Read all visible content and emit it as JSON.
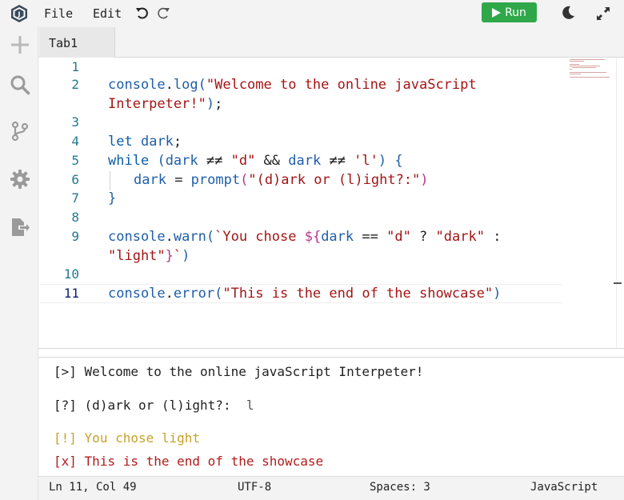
{
  "menu": {
    "file": "File",
    "edit": "Edit"
  },
  "toolbar": {
    "run_label": "Run",
    "run_color": "#2fa84a"
  },
  "tabs": [
    {
      "label": "Tab1"
    }
  ],
  "editor": {
    "line_numbers": [
      "1",
      "2",
      "",
      "3",
      "4",
      "5",
      "6",
      "7",
      "8",
      "9",
      "",
      "10",
      "11"
    ],
    "code": {
      "l2a": [
        "console",
        ".",
        "log",
        "(",
        "\"Welcome to the online javaScript"
      ],
      "l2b": [
        "Interpeter!\"",
        ")",
        ";"
      ],
      "l4": [
        "let",
        " ",
        "dark",
        ";"
      ],
      "l5": [
        "while",
        " ",
        "(",
        "dark",
        " ≠≠ ",
        "\"d\"",
        " && ",
        "dark",
        " ≠≠ ",
        "'l'",
        ")",
        " ",
        "{"
      ],
      "l6": [
        "dark",
        " = ",
        "prompt",
        "(",
        "\"(d)ark or (l)ight?:\"",
        ")"
      ],
      "l7": [
        "}"
      ],
      "l9a": [
        "console",
        ".",
        "warn",
        "(",
        "`You chose ",
        "${",
        "dark",
        " == ",
        "\"d\"",
        " ? ",
        "\"dark\"",
        " :"
      ],
      "l9b": [
        "\"light\"",
        "}",
        "`",
        ")"
      ],
      "l11": [
        "console",
        ".",
        "error",
        "(",
        "\"This is the end of the showcase\"",
        ")"
      ]
    }
  },
  "console": {
    "lines": [
      {
        "prefix": "[>]",
        "text": "Welcome to the online javaScript Interpeter!",
        "type": "log"
      },
      {
        "prefix": "[?]",
        "text": "(d)ark or (l)ight?:",
        "input": "l",
        "type": "prompt"
      },
      {
        "prefix": "[!]",
        "text": "You chose light",
        "type": "warn"
      },
      {
        "prefix": "[x]",
        "text": "This is the end of the showcase",
        "type": "error"
      }
    ]
  },
  "status": {
    "position": "Ln 11, Col 49",
    "encoding": "UTF-8",
    "spaces": "Spaces: 3",
    "language": "JavaScript"
  },
  "icons": {
    "logo": "js-logo-icon",
    "undo": "undo-icon",
    "redo": "redo-icon",
    "theme": "moon-icon",
    "expand": "expand-icon",
    "sidebar": [
      "plus-icon",
      "search-icon",
      "source-control-icon",
      "gear-icon",
      "export-icon"
    ]
  },
  "colors": {
    "identifier": "#1f5ea8",
    "string": "#a31515",
    "warn": "#c8a12b",
    "error": "#b21c1c"
  }
}
